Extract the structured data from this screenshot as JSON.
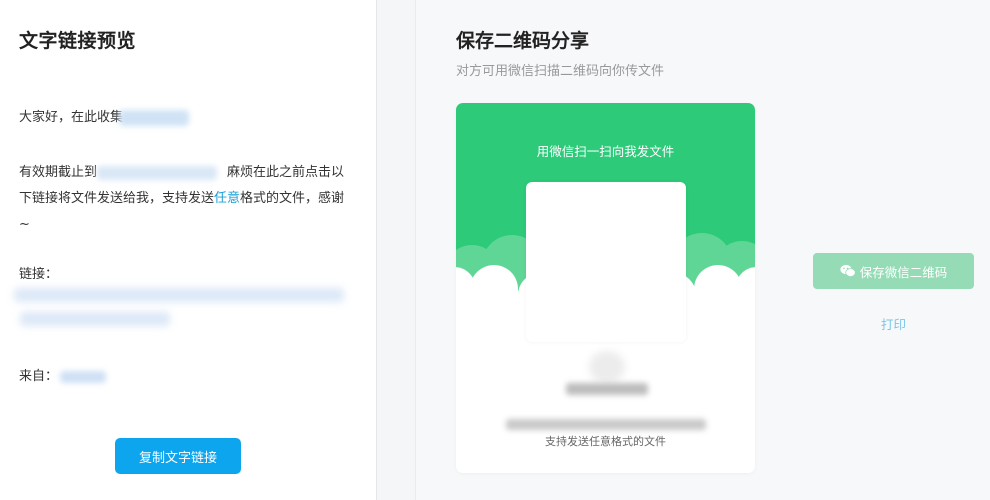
{
  "left": {
    "title": "文字链接预览",
    "greeting": "大家好，在此收集",
    "validity_prefix": "有效期截止到",
    "validity_mid": "麻烦在此之前点击以下链接将文件发送给我，支持发送",
    "validity_highlight": "任意",
    "validity_suffix": "格式的文件，感谢~",
    "link_label": "链接：",
    "from_label": "来自：",
    "copy_button": "复制文字链接"
  },
  "right": {
    "title": "保存二维码分享",
    "subtitle": "对方可用微信扫描二维码向你传文件",
    "card": {
      "scan_text": "用微信扫一扫向我发文件",
      "support_text": "支持发送任意格式的文件"
    },
    "save_button": "保存微信二维码",
    "print_link": "打印"
  },
  "colors": {
    "primary_blue": "#0ea5ef",
    "wechat_green": "#2dca7a",
    "save_btn_green": "#95dcb6",
    "link_blue": "#7ac6ea"
  }
}
